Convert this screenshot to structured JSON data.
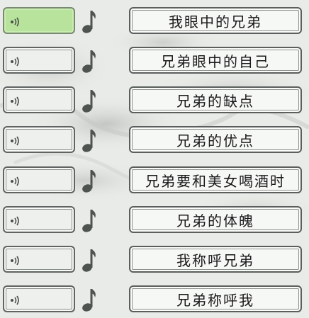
{
  "colors": {
    "active": "#b8e39c",
    "background": "#e9ebe8"
  },
  "rows": [
    {
      "label": "我眼中的兄弟",
      "active": true
    },
    {
      "label": "兄弟眼中的自己",
      "active": false
    },
    {
      "label": "兄弟的缺点",
      "active": false
    },
    {
      "label": "兄弟的优点",
      "active": false
    },
    {
      "label": "兄弟要和美女喝酒时",
      "active": false
    },
    {
      "label": "兄弟的体魄",
      "active": false
    },
    {
      "label": "我称呼兄弟",
      "active": false
    },
    {
      "label": "兄弟称呼我",
      "active": false
    }
  ],
  "icons": {
    "sound": "speaker-icon",
    "music": "music-note-icon"
  }
}
